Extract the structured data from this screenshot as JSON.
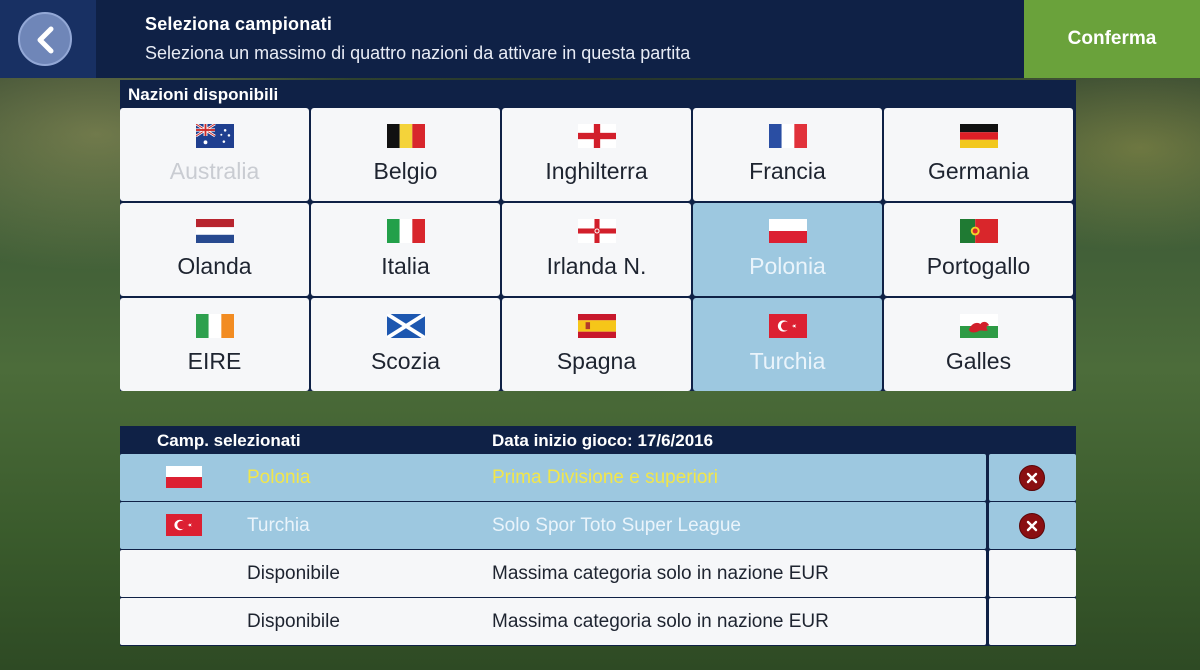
{
  "header": {
    "title": "Seleziona campionati",
    "subtitle": "Seleziona un massimo di quattro nazioni da attivare in questa partita",
    "confirm_label": "Conferma",
    "back_icon": "chevron-left-icon"
  },
  "nations_panel": {
    "title": "Nazioni disponibili",
    "nations": [
      {
        "name": "Australia",
        "flag": "australia",
        "state": "disabled"
      },
      {
        "name": "Belgio",
        "flag": "belgium",
        "state": "normal"
      },
      {
        "name": "Inghilterra",
        "flag": "england",
        "state": "normal"
      },
      {
        "name": "Francia",
        "flag": "france",
        "state": "normal"
      },
      {
        "name": "Germania",
        "flag": "germany",
        "state": "normal"
      },
      {
        "name": "Olanda",
        "flag": "netherlands",
        "state": "normal"
      },
      {
        "name": "Italia",
        "flag": "italy",
        "state": "normal"
      },
      {
        "name": "Irlanda N.",
        "flag": "northern-ireland",
        "state": "normal"
      },
      {
        "name": "Polonia",
        "flag": "poland",
        "state": "selected"
      },
      {
        "name": "Portogallo",
        "flag": "portugal",
        "state": "normal"
      },
      {
        "name": "EIRE",
        "flag": "ireland",
        "state": "normal"
      },
      {
        "name": "Scozia",
        "flag": "scotland",
        "state": "normal"
      },
      {
        "name": "Spagna",
        "flag": "spain",
        "state": "normal"
      },
      {
        "name": "Turchia",
        "flag": "turkey",
        "state": "selected"
      },
      {
        "name": "Galles",
        "flag": "wales",
        "state": "normal"
      }
    ]
  },
  "selected_panel": {
    "col_nation": "Camp. selezionati",
    "col_start": "Data inizio gioco: 17/6/2016",
    "rows": [
      {
        "flag": "poland",
        "nation": "Polonia",
        "league": "Prima Divisione e superiori",
        "selected": true,
        "color": "yellow",
        "removable": true
      },
      {
        "flag": "turkey",
        "nation": "Turchia",
        "league": "Solo Spor Toto Super League",
        "selected": true,
        "color": "white",
        "removable": true
      },
      {
        "flag": "",
        "nation": "Disponibile",
        "league": "Massima categoria solo in nazione EUR",
        "selected": false,
        "color": "dark",
        "removable": false
      },
      {
        "flag": "",
        "nation": "Disponibile",
        "league": "Massima categoria solo in nazione EUR",
        "selected": false,
        "color": "dark",
        "removable": false
      }
    ]
  },
  "colors": {
    "header_bg": "#0f2146",
    "confirm_bg": "#6aa23b",
    "selected_bg": "#9dc8e0",
    "remove_icon": "#8a0f12"
  }
}
